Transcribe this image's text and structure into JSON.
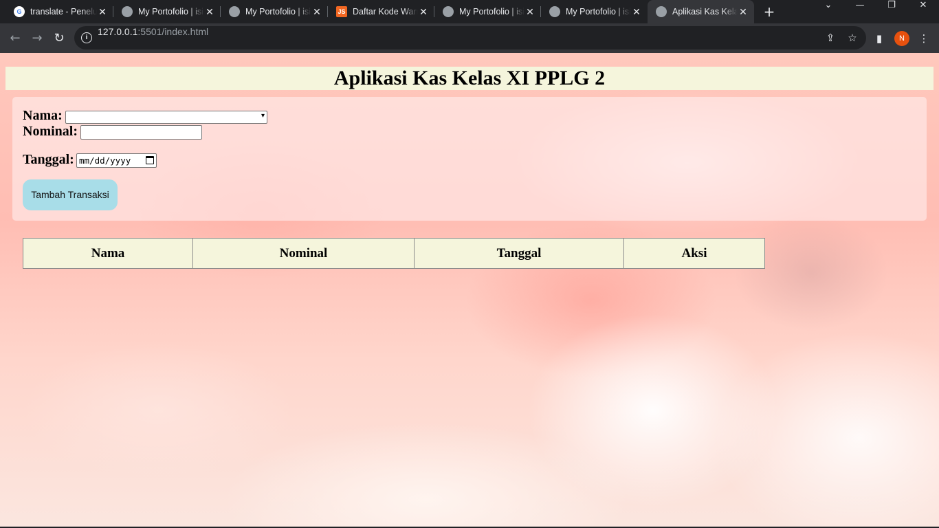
{
  "browser": {
    "tabs": [
      {
        "title": "translate - Penelusuran Google",
        "favicon": "google-icon",
        "active": false
      },
      {
        "title": "My Portofolio | isi",
        "favicon": "globe-icon",
        "active": false
      },
      {
        "title": "My Portofolio | isi",
        "favicon": "globe-icon",
        "active": false
      },
      {
        "title": "Daftar Kode Warna",
        "favicon": "js-icon",
        "active": false
      },
      {
        "title": "My Portofolio | isi",
        "favicon": "globe-icon",
        "active": false
      },
      {
        "title": "My Portofolio | isi",
        "favicon": "globe-icon",
        "active": false
      },
      {
        "title": "Aplikasi Kas Kelas",
        "favicon": "globe-icon",
        "active": true
      }
    ],
    "new_tab_glyph": "+",
    "url_host": "127.0.0.1",
    "url_rest": ":5501/index.html",
    "profile_initial": "N",
    "favicon_glyph_google": "G",
    "favicon_glyph_js": "JS",
    "glyphs": {
      "close": "✕",
      "back": "←",
      "forward": "→",
      "reload": "↻",
      "info": "i",
      "share": "⇪",
      "star": "☆",
      "sidepanel": "▮",
      "menu": "⋮",
      "chevron_down": "⌄",
      "minimize": "—",
      "restore": "❐",
      "win_close": "✕",
      "select_chevron": "▾"
    }
  },
  "page": {
    "title": "Aplikasi Kas Kelas XI PPLG 2",
    "form": {
      "nama_label": "Nama:",
      "nama_value": "",
      "nominal_label": "Nominal:",
      "nominal_value": "",
      "tanggal_label": "Tanggal:",
      "tanggal_placeholder": "mm/dd/yyyy",
      "submit_label": "Tambah Transaksi"
    },
    "table": {
      "headers": [
        "Nama",
        "Nominal",
        "Tanggal",
        "Aksi"
      ]
    }
  },
  "colors": {
    "header_bg": "#f5f5dc",
    "button_bg": "#a8dde8",
    "chrome_dark": "#202124",
    "chrome_toolbar": "#35363a",
    "avatar": "#e8510e"
  }
}
